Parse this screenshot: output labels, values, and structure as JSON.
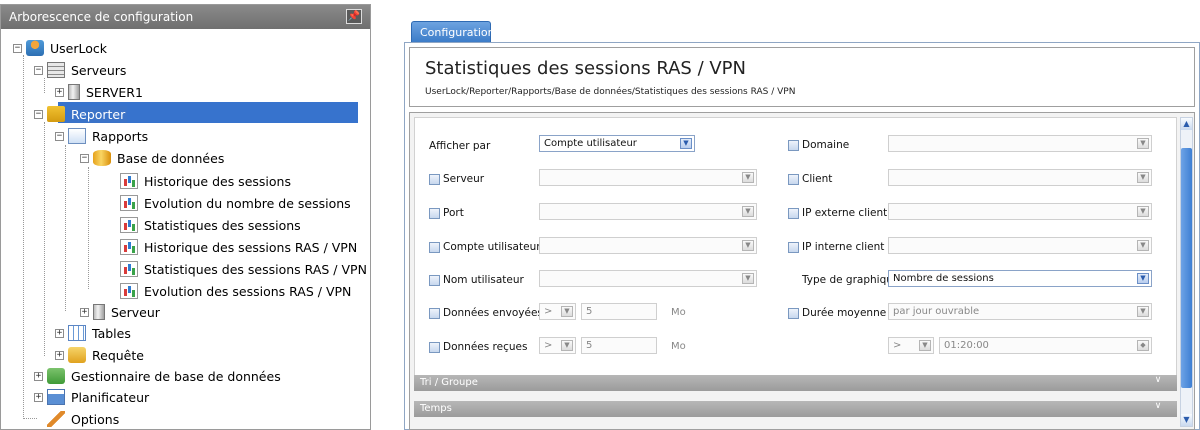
{
  "tree": {
    "title": "Arborescence de configuration",
    "pin": "↕",
    "items": [
      {
        "label": "UserLock"
      },
      {
        "label": "Serveurs"
      },
      {
        "label": "SERVER1"
      },
      {
        "label": "Reporter"
      },
      {
        "label": "Rapports"
      },
      {
        "label": "Base de données"
      },
      {
        "label": "Historique des sessions"
      },
      {
        "label": "Evolution du nombre de sessions"
      },
      {
        "label": "Statistiques des sessions"
      },
      {
        "label": "Historique des sessions RAS / VPN"
      },
      {
        "label": "Statistiques des sessions RAS / VPN"
      },
      {
        "label": "Evolution des sessions RAS / VPN"
      },
      {
        "label": "Serveur"
      },
      {
        "label": "Tables"
      },
      {
        "label": "Requête"
      },
      {
        "label": "Gestionnaire de base de données"
      },
      {
        "label": "Planificateur"
      },
      {
        "label": "Options"
      }
    ]
  },
  "tab": {
    "label": "Configuration"
  },
  "page": {
    "title": "Statistiques des sessions RAS / VPN",
    "breadcrumb": "UserLock/Reporter/Rapports/Base de données/Statistiques des sessions RAS / VPN"
  },
  "form": {
    "afficher_par": {
      "label": "Afficher par",
      "value": "Compte utilisateur"
    },
    "serveur": {
      "label": "Serveur"
    },
    "port": {
      "label": "Port"
    },
    "compte_utilisateur": {
      "label": "Compte utilisateur"
    },
    "nom_utilisateur": {
      "label": "Nom utilisateur"
    },
    "donnees_envoyees": {
      "label": "Données envoyées",
      "op": ">",
      "value": "5",
      "unit": "Mo"
    },
    "donnees_recues": {
      "label": "Données reçues",
      "op": ">",
      "value": "5",
      "unit": "Mo"
    },
    "domaine": {
      "label": "Domaine"
    },
    "client": {
      "label": "Client"
    },
    "ip_externe": {
      "label": "IP externe client"
    },
    "ip_interne": {
      "label": "IP interne client"
    },
    "type_graphique": {
      "label": "Type de graphique",
      "value": "Nombre de sessions"
    },
    "duree_moyenne": {
      "label": "Durée moyenne",
      "value": "par jour ouvrable"
    },
    "duree_filter": {
      "op": ">",
      "value": "01:20:00"
    }
  },
  "sections": {
    "tri_groupe": "Tri / Groupe",
    "temps": "Temps"
  },
  "colors": {
    "selection": "#3773cd",
    "tab": "#4a87cf",
    "section_bar": "#a9a9a9"
  }
}
